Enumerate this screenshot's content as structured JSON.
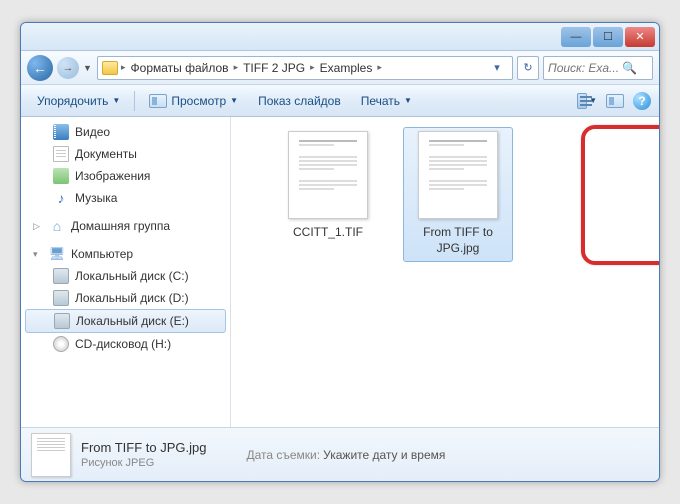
{
  "breadcrumb": {
    "sep": "▸",
    "items": [
      "Форматы файлов",
      "TIFF 2 JPG",
      "Examples"
    ]
  },
  "search": {
    "placeholder": "Поиск: Exa..."
  },
  "toolbar": {
    "organize": "Упорядочить",
    "preview": "Просмотр",
    "slideshow": "Показ слайдов",
    "print": "Печать"
  },
  "sidebar": {
    "video": "Видео",
    "documents": "Документы",
    "pictures": "Изображения",
    "music": "Музыка",
    "homegroup": "Домашняя группа",
    "computer": "Компьютер",
    "disk_c": "Локальный диск (C:)",
    "disk_d": "Локальный диск (D:)",
    "disk_e": "Локальный диск (E:)",
    "cd_h": "CD-дисковод (H:)"
  },
  "files": [
    {
      "name": "CCITT_1.TIF"
    },
    {
      "name": "From TIFF to JPG.jpg"
    }
  ],
  "details": {
    "name": "From TIFF to JPG.jpg",
    "type": "Рисунок JPEG",
    "date_label": "Дата съемки:",
    "date_value": "Укажите дату и время"
  }
}
